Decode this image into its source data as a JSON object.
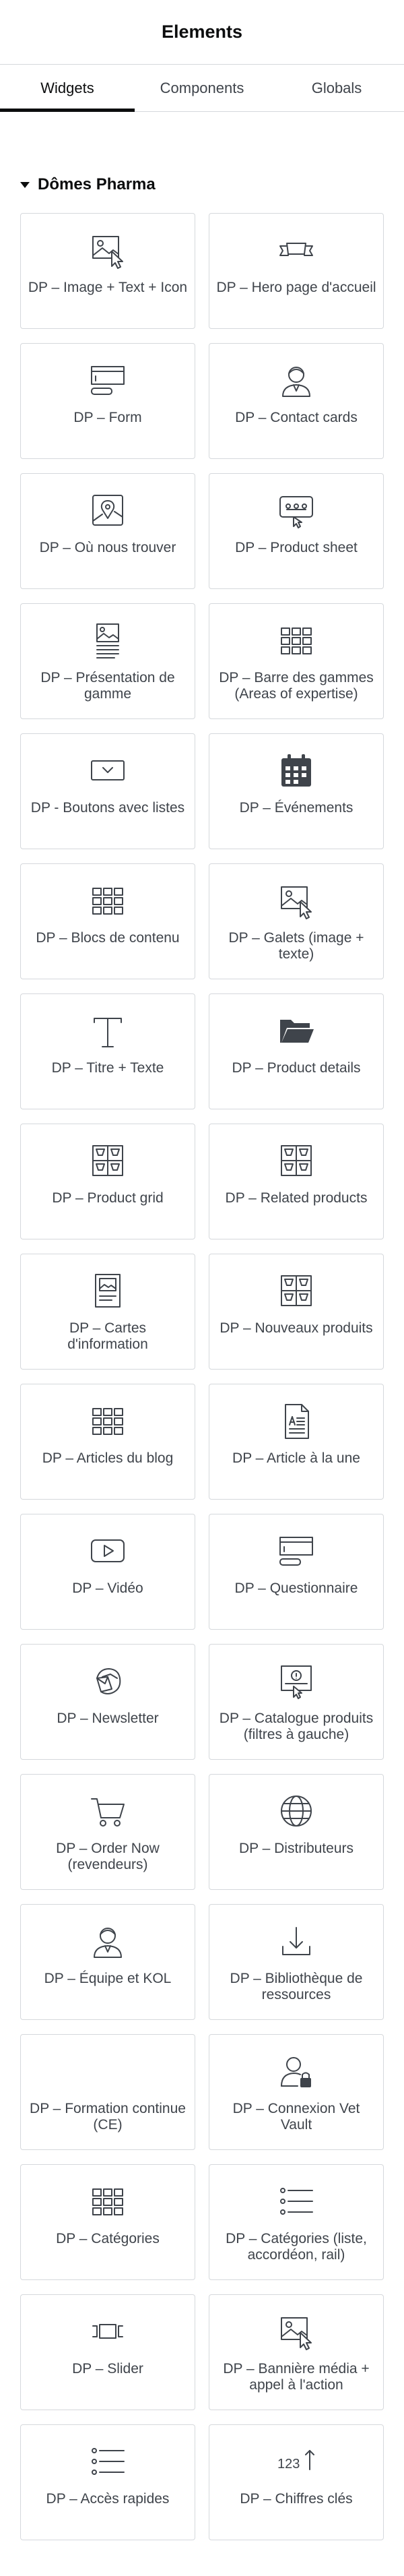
{
  "header": {
    "title": "Elements"
  },
  "tabs": [
    {
      "label": "Widgets",
      "active": true
    },
    {
      "label": "Components",
      "active": false
    },
    {
      "label": "Globals",
      "active": false
    }
  ],
  "category": {
    "label": "Dômes Pharma"
  },
  "widgets": [
    {
      "label": "DP – Image + Text + Icon",
      "icon": "image-cursor-icon"
    },
    {
      "label": "DP – Hero page d'accueil",
      "icon": "banner-icon"
    },
    {
      "label": "DP – Form",
      "icon": "form-icon"
    },
    {
      "label": "DP – Contact cards",
      "icon": "person-icon"
    },
    {
      "label": "DP – Où nous trouver",
      "icon": "map-pin-icon"
    },
    {
      "label": "DP – Product sheet",
      "icon": "product-sheet-icon"
    },
    {
      "label": "DP – Présentation de gamme",
      "icon": "document-image-icon"
    },
    {
      "label": "DP – Barre des gammes (Areas of expertise)",
      "icon": "grid-icon"
    },
    {
      "label": "DP - Boutons avec listes",
      "icon": "dropdown-icon"
    },
    {
      "label": "DP – Événements",
      "icon": "calendar-icon"
    },
    {
      "label": "DP – Blocs de contenu",
      "icon": "grid-icon"
    },
    {
      "label": "DP – Galets (image + texte)",
      "icon": "image-cursor-icon"
    },
    {
      "label": "DP – Titre + Texte",
      "icon": "text-icon"
    },
    {
      "label": "DP – Product details",
      "icon": "folder-icon"
    },
    {
      "label": "DP – Product grid",
      "icon": "product-grid-icon"
    },
    {
      "label": "DP – Related products",
      "icon": "product-grid-icon"
    },
    {
      "label": "DP – Cartes d'information",
      "icon": "info-card-icon"
    },
    {
      "label": "DP – Nouveaux produits",
      "icon": "product-grid-icon"
    },
    {
      "label": "DP – Articles du blog",
      "icon": "grid-icon"
    },
    {
      "label": "DP – Article à la une",
      "icon": "article-icon"
    },
    {
      "label": "DP – Vidéo",
      "icon": "video-icon"
    },
    {
      "label": "DP – Questionnaire",
      "icon": "form-icon"
    },
    {
      "label": "DP – Newsletter",
      "icon": "mail-icon"
    },
    {
      "label": "DP – Catalogue produits (filtres à gauche)",
      "icon": "catalogue-icon"
    },
    {
      "label": "DP – Order Now (revendeurs)",
      "icon": "cart-icon"
    },
    {
      "label": "DP – Distributeurs",
      "icon": "globe-icon"
    },
    {
      "label": "DP – Équipe et KOL",
      "icon": "person-icon"
    },
    {
      "label": "DP – Bibliothèque de ressources",
      "icon": "download-icon"
    },
    {
      "label": "DP – Formation continue (CE)",
      "icon": ""
    },
    {
      "label": "DP – Connexion Vet Vault",
      "icon": "user-lock-icon"
    },
    {
      "label": "DP – Catégories",
      "icon": "grid-icon"
    },
    {
      "label": "DP – Catégories (liste, accordéon, rail)",
      "icon": "list-icon"
    },
    {
      "label": "DP – Slider",
      "icon": "slider-icon"
    },
    {
      "label": "DP – Bannière média + appel à l'action",
      "icon": "image-cursor-icon"
    },
    {
      "label": "DP – Accès rapides",
      "icon": "list-icon"
    },
    {
      "label": "DP – Chiffres clés",
      "icon": "counter-icon"
    }
  ],
  "counter_icon_text": "123"
}
